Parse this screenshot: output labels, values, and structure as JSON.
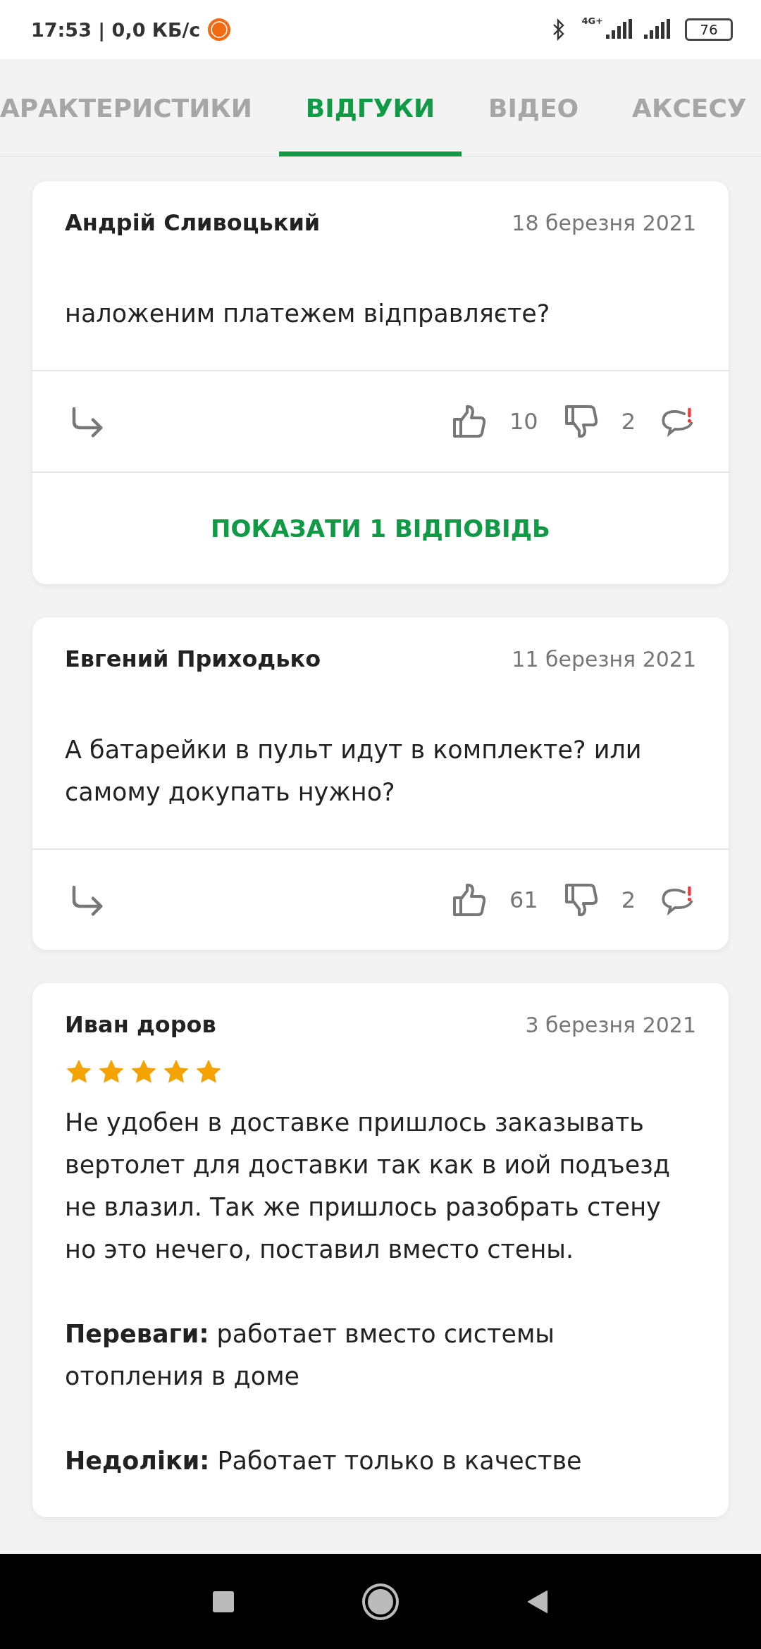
{
  "status_bar": {
    "time": "17:53 | 0,0 КБ/с",
    "network": "4G+",
    "battery": "76"
  },
  "tabs": [
    {
      "label": "АРАКТЕРИСТИКИ",
      "selected": false
    },
    {
      "label": "ВІДГУКИ",
      "selected": true
    },
    {
      "label": "ВІДЕО",
      "selected": false
    },
    {
      "label": "АКСЕСУ",
      "selected": false
    }
  ],
  "reviews": [
    {
      "author": "Андрій Сливоцький",
      "date": "18 березня 2021",
      "paragraphs": [
        "наложеним платежем відправляєте?"
      ],
      "likes": "10",
      "dislikes": "2",
      "replies_button": "ПОКАЗАТИ 1 ВІДПОВІДЬ"
    },
    {
      "author": "Евгений Приходько",
      "date": "11 березня 2021",
      "paragraphs": [
        "А батарейки в пульт идут в комплекте? или самому докупать нужно?"
      ],
      "likes": "61",
      "dislikes": "2"
    },
    {
      "author": "Иван доров",
      "date": "3 березня 2021",
      "stars": 5,
      "paragraphs": [
        "Не удобен в доставке пришлось заказывать вертолет для доставки так как в иой подъезд не влазил. Так же пришлось разобрать стену но это нечего, поставил вместо стены.",
        "**Переваги:** работает вместо системы отопления в доме",
        "**Недоліки:** Работает только в качестве"
      ]
    }
  ]
}
